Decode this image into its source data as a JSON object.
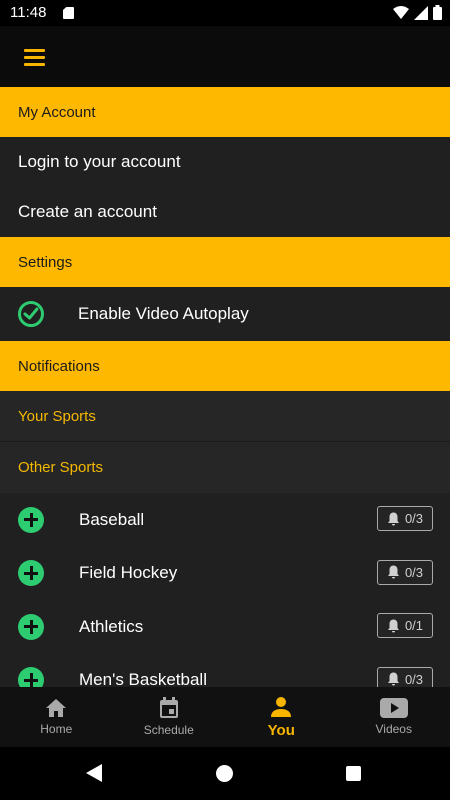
{
  "status_bar": {
    "time": "11:48"
  },
  "menu": {
    "label": ""
  },
  "sections": {
    "my_account": {
      "title": "My Account",
      "login": "Login to your account",
      "create": "Create an account"
    },
    "settings": {
      "title": "Settings",
      "autoplay": "Enable Video Autoplay"
    },
    "notifications": {
      "title": "Notifications",
      "your_sports": "Your Sports",
      "other_sports": "Other Sports"
    }
  },
  "sports": [
    {
      "name": "Baseball",
      "count": "0/3"
    },
    {
      "name": "Field Hockey",
      "count": "0/3"
    },
    {
      "name": "Athletics",
      "count": "0/1"
    },
    {
      "name": "Men's Basketball",
      "count": "0/3"
    }
  ],
  "bottom_nav": {
    "home": "Home",
    "schedule": "Schedule",
    "you": "You",
    "videos": "Videos"
  },
  "colors": {
    "accent": "#ffb800",
    "positive": "#2ecc71",
    "background": "#202020"
  }
}
